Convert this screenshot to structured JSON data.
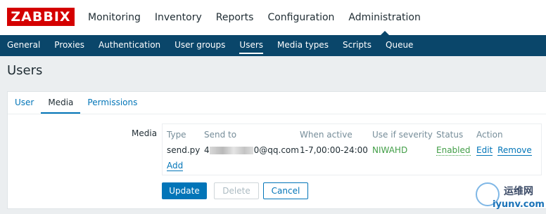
{
  "logo": "ZABBIX",
  "main_nav": [
    "Monitoring",
    "Inventory",
    "Reports",
    "Configuration",
    "Administration"
  ],
  "main_nav_active": "Administration",
  "sub_nav": [
    "General",
    "Proxies",
    "Authentication",
    "User groups",
    "Users",
    "Media types",
    "Scripts",
    "Queue"
  ],
  "sub_nav_active": "Users",
  "page_title": "Users",
  "tabs": [
    "User",
    "Media",
    "Permissions"
  ],
  "tabs_active": "Media",
  "media": {
    "label": "Media",
    "headers": [
      "Type",
      "Send to",
      "When active",
      "Use if severity",
      "Status",
      "Action"
    ],
    "row": {
      "type": "send.py",
      "send_to_prefix": "4",
      "send_to_suffix": "0@qq.com",
      "when_active": "1-7,00:00-24:00",
      "severity": "NIWAHD",
      "status": "Enabled",
      "edit": "Edit",
      "remove": "Remove"
    },
    "add": "Add"
  },
  "buttons": {
    "update": "Update",
    "delete": "Delete",
    "cancel": "Cancel"
  },
  "watermark": {
    "line1": "运维网",
    "line2": "iyunv.com"
  },
  "colors": {
    "brand_red": "#d40000",
    "nav_blue": "#0a466a",
    "link_blue": "#0275b8",
    "enabled_green": "#429e47"
  }
}
